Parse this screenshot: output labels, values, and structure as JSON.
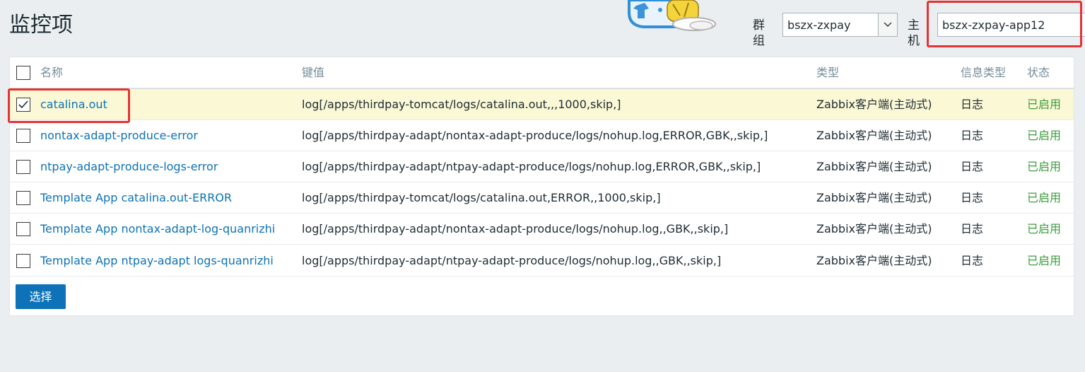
{
  "page": {
    "title": "监控项"
  },
  "filters": {
    "group_label": "群组",
    "group_value": "bszx-zxpay",
    "host_label": "主机",
    "host_value": "bszx-zxpay-app12"
  },
  "table": {
    "columns": {
      "name": "名称",
      "key": "键值",
      "type": "类型",
      "info_type": "信息类型",
      "status": "状态"
    },
    "rows": [
      {
        "checked": true,
        "name": "catalina.out",
        "key": "log[/apps/thirdpay-tomcat/logs/catalina.out,,,1000,skip,]",
        "type": "Zabbix客户端(主动式)",
        "info_type": "日志",
        "status": "已启用"
      },
      {
        "checked": false,
        "name": "nontax-adapt-produce-error",
        "key": "log[/apps/thirdpay-adapt/nontax-adapt-produce/logs/nohup.log,ERROR,GBK,,skip,]",
        "type": "Zabbix客户端(主动式)",
        "info_type": "日志",
        "status": "已启用"
      },
      {
        "checked": false,
        "name": "ntpay-adapt-produce-logs-error",
        "key": "log[/apps/thirdpay-adapt/ntpay-adapt-produce/logs/nohup.log,ERROR,GBK,,skip,]",
        "type": "Zabbix客户端(主动式)",
        "info_type": "日志",
        "status": "已启用"
      },
      {
        "checked": false,
        "name": "Template App catalina.out-ERROR",
        "key": "log[/apps/thirdpay-tomcat/logs/catalina.out,ERROR,,1000,skip,]",
        "type": "Zabbix客户端(主动式)",
        "info_type": "日志",
        "status": "已启用"
      },
      {
        "checked": false,
        "name": "Template App nontax-adapt-log-quanrizhi",
        "key": "log[/apps/thirdpay-adapt/nontax-adapt-produce/logs/nohup.log,,GBK,,skip,]",
        "type": "Zabbix客户端(主动式)",
        "info_type": "日志",
        "status": "已启用"
      },
      {
        "checked": false,
        "name": "Template App ntpay-adapt logs-quanrizhi",
        "key": "log[/apps/thirdpay-adapt/ntpay-adapt-produce/logs/nohup.log,,GBK,,skip,]",
        "type": "Zabbix客户端(主动式)",
        "info_type": "日志",
        "status": "已启用"
      }
    ]
  },
  "actions": {
    "select_label": "选择"
  },
  "colors": {
    "link": "#0d72b8",
    "status_enabled": "#3b9c3b",
    "selected_row": "#fbf8d5",
    "highlight": "#e53333",
    "primary_button": "#0d72b8"
  },
  "icons": {
    "mascot": "cartoon-mascot-icon",
    "dropdown": "chevron-down-icon",
    "check": "checkmark-icon"
  }
}
